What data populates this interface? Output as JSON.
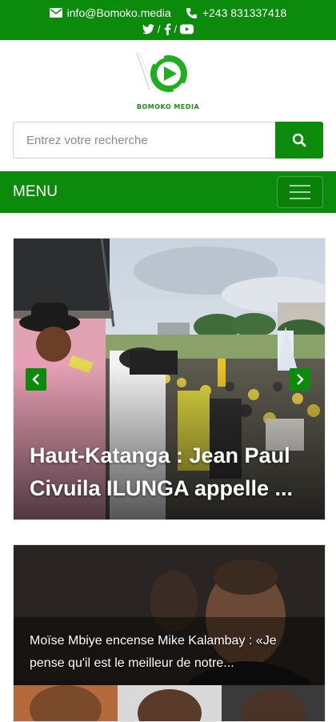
{
  "topbar": {
    "email": "info@Bomoko.media",
    "phone": "+243 831337418",
    "social_separator_1": "/",
    "social_separator_2": "/"
  },
  "logo": {
    "text": "BOMOKO MEDIA"
  },
  "search": {
    "placeholder": "Entrez votre recherche"
  },
  "menu": {
    "label": "MENU"
  },
  "articles": [
    {
      "title": "Haut-Katanga : Jean Paul Civuila ILUNGA appelle ..."
    },
    {
      "title": "Moïse Mbiye encense Mike Kalambay : «Je pense qu'il est le meilleur de notre..."
    }
  ],
  "colors": {
    "brand_green": "#0b8a0b",
    "white": "#ffffff"
  },
  "icons": [
    "envelope-icon",
    "phone-icon",
    "twitter-icon",
    "facebook-icon",
    "youtube-icon",
    "search-icon",
    "hamburger-icon",
    "chevron-left-icon",
    "chevron-right-icon",
    "play-logo-icon"
  ]
}
